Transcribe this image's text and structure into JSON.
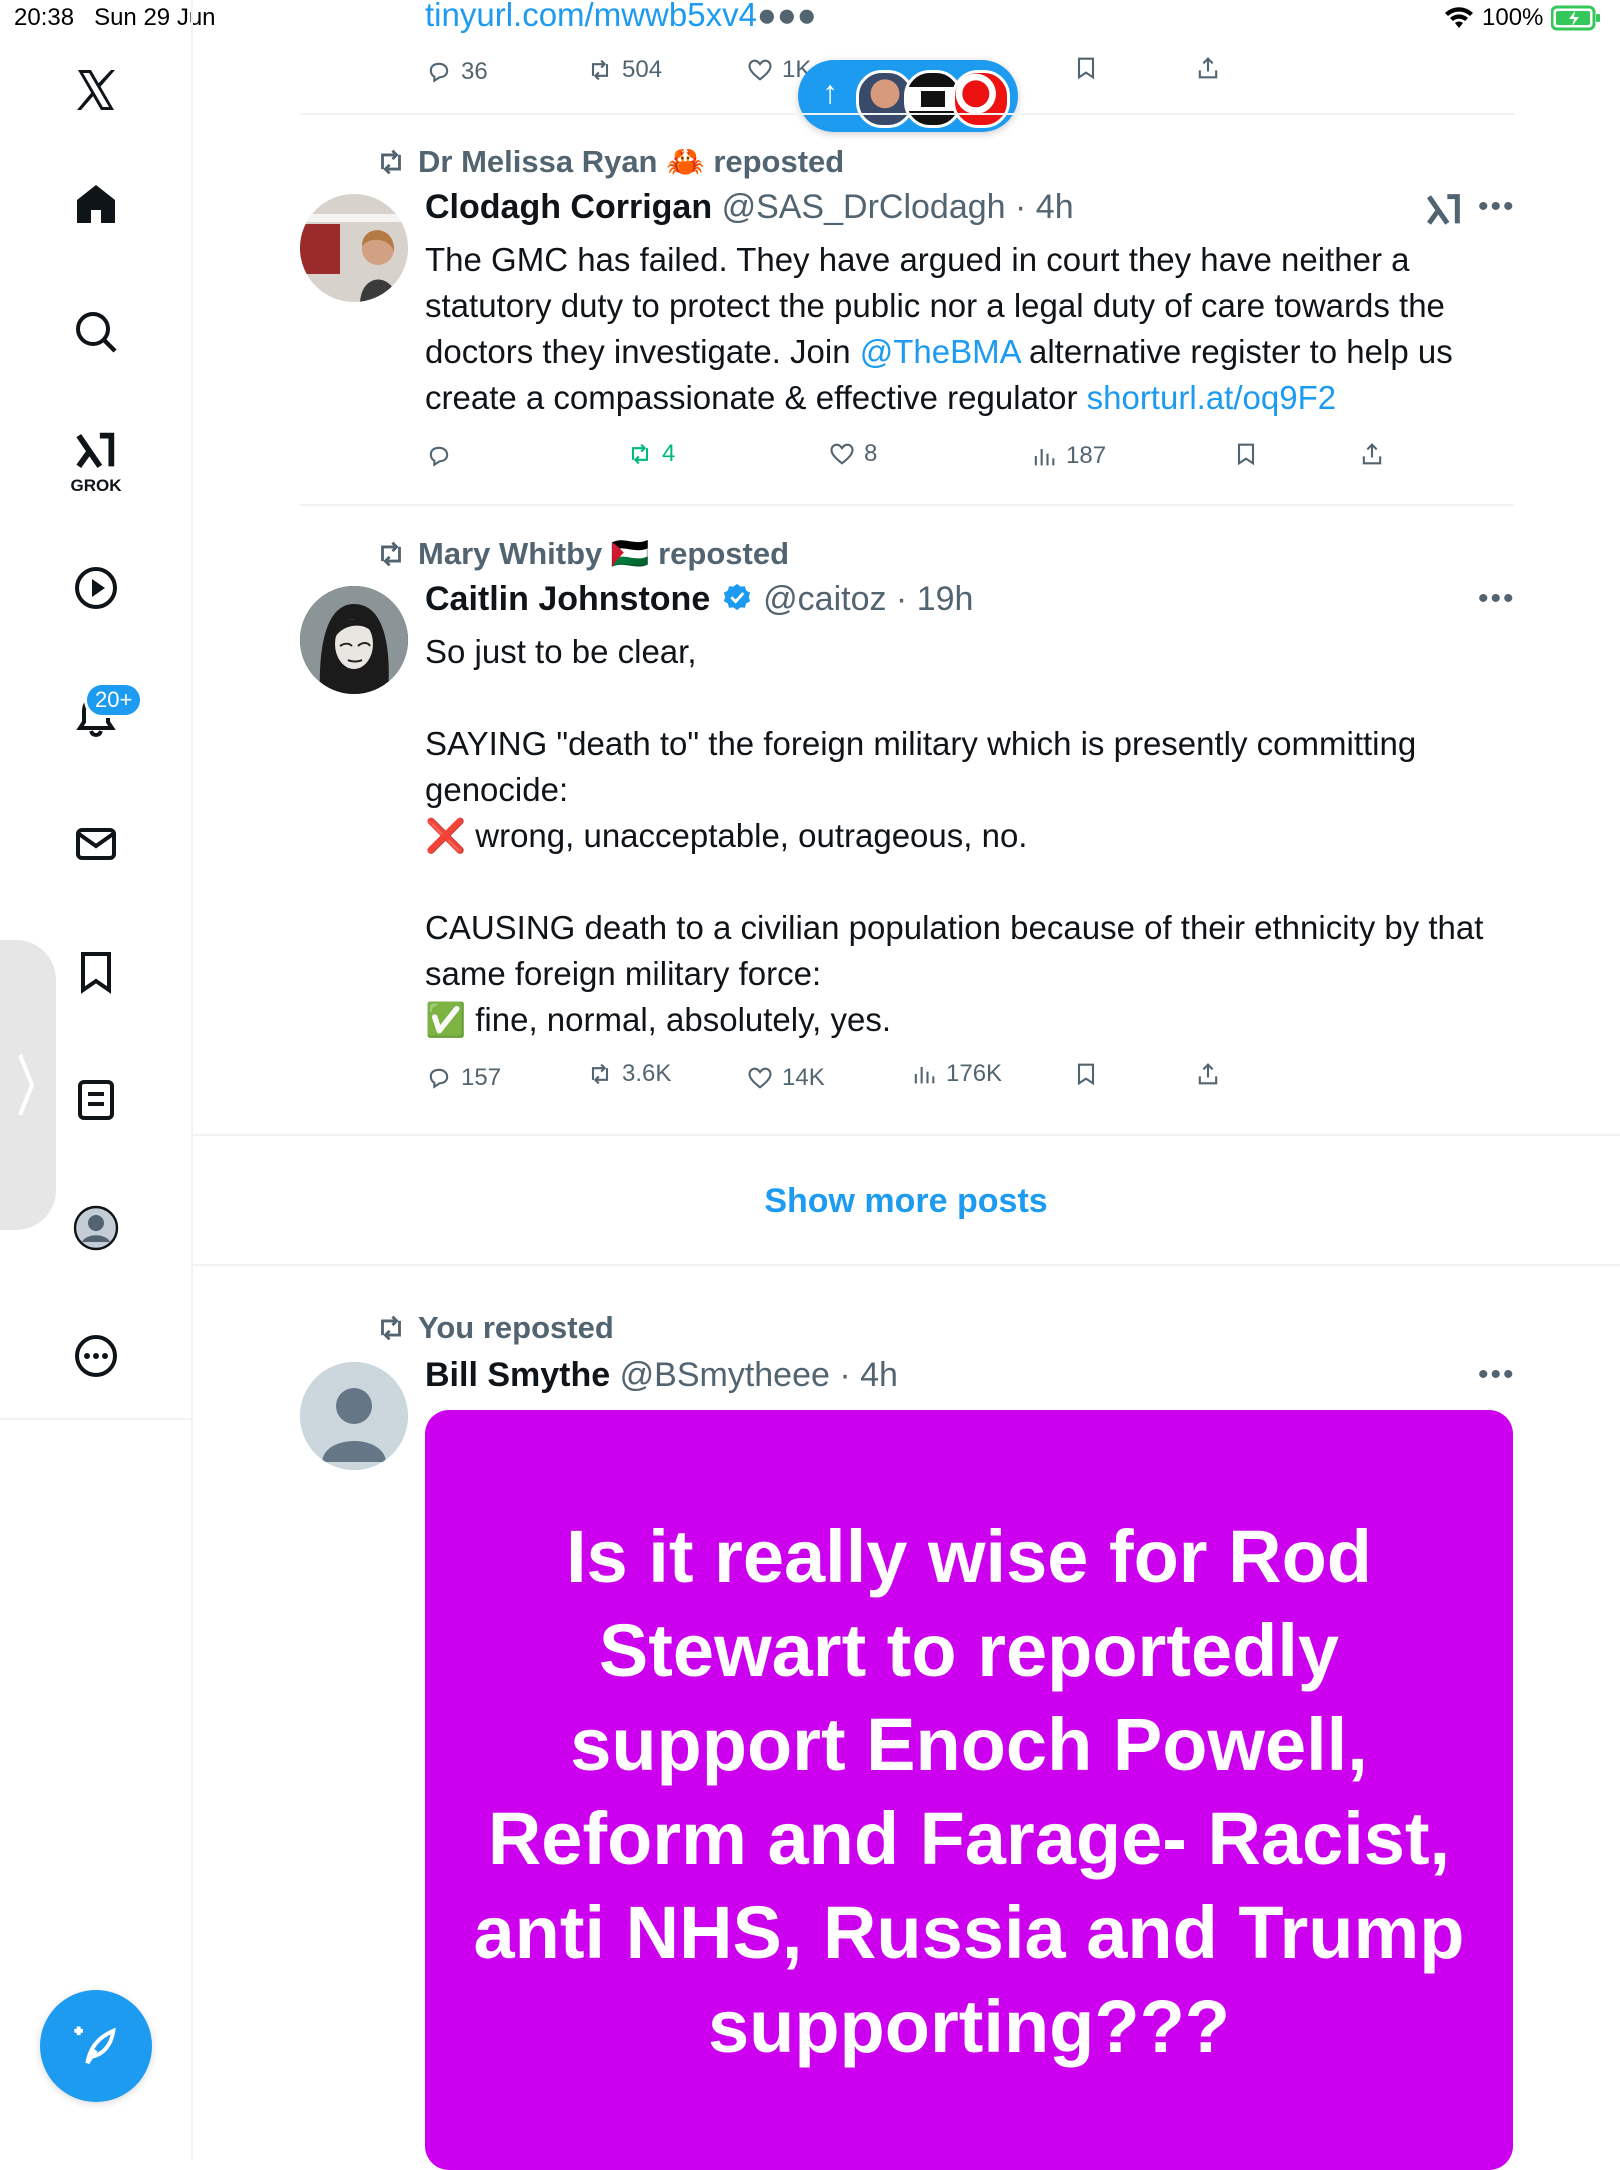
{
  "status_bar": {
    "time": "20:38",
    "date": "Sun 29 Jun",
    "battery": "100%"
  },
  "sidebar": {
    "logo": "X",
    "items": [
      {
        "name": "home",
        "icon": "home-icon"
      },
      {
        "name": "explore",
        "icon": "search-icon"
      },
      {
        "name": "grok",
        "icon": "grok-icon",
        "label": "GROK"
      },
      {
        "name": "videos",
        "icon": "play-icon"
      },
      {
        "name": "notifications",
        "icon": "bell-icon",
        "badge": "20+"
      },
      {
        "name": "messages",
        "icon": "mail-icon"
      },
      {
        "name": "bookmarks",
        "icon": "bookmark-icon"
      },
      {
        "name": "lists",
        "icon": "list-icon"
      },
      {
        "name": "profile",
        "icon": "profile-icon"
      },
      {
        "name": "more",
        "icon": "more-icon"
      }
    ],
    "compose_icon": "compose-icon"
  },
  "top_tweet": {
    "link": "tinyurl.com/mwwb5xv4",
    "replies": "36",
    "reposts": "504",
    "likes": "1K"
  },
  "new_posts_pill": {
    "arrow": "↑"
  },
  "tweets": [
    {
      "reposted_by": "Dr Melissa Ryan 🦀 reposted",
      "name": "Clodagh Corrigan",
      "handle": "@SAS_DrClodagh",
      "time": "4h",
      "text_before": "The GMC has failed. They have argued in court they have neither a statutory duty to protect the public nor a legal duty of care towards the doctors they investigate. Join ",
      "mention": "@TheBMA",
      "text_after": " alternative register to help us create a compassionate & effective regulator ",
      "link": "shorturl.at/oq9F2",
      "replies": "",
      "reposts": "4",
      "likes": "8",
      "views": "187"
    },
    {
      "reposted_by": "Mary Whitby 🇵🇸 reposted",
      "name": "Caitlin Johnstone",
      "handle": "@caitoz",
      "time": "19h",
      "lines": [
        "So just to be clear,",
        "",
        "SAYING \"death to\" the foreign military which is presently committing genocide:",
        "❌ wrong, unacceptable, outrageous, no.",
        "",
        "CAUSING death to a civilian population because of their ethnicity by that same foreign military force:",
        "✅ fine, normal, absolutely, yes."
      ],
      "replies": "157",
      "reposts": "3.6K",
      "likes": "14K",
      "views": "176K"
    }
  ],
  "show_more": "Show more posts",
  "bottom_tweet": {
    "reposted_by": "You reposted",
    "name": "Bill Smythe",
    "handle": "@BSmytheee",
    "time": "4h",
    "image_text": "Is it really wise for Rod Stewart to reportedly support Enoch Powell, Reform and Farage- Racist, anti NHS, Russia and Trump supporting???"
  }
}
